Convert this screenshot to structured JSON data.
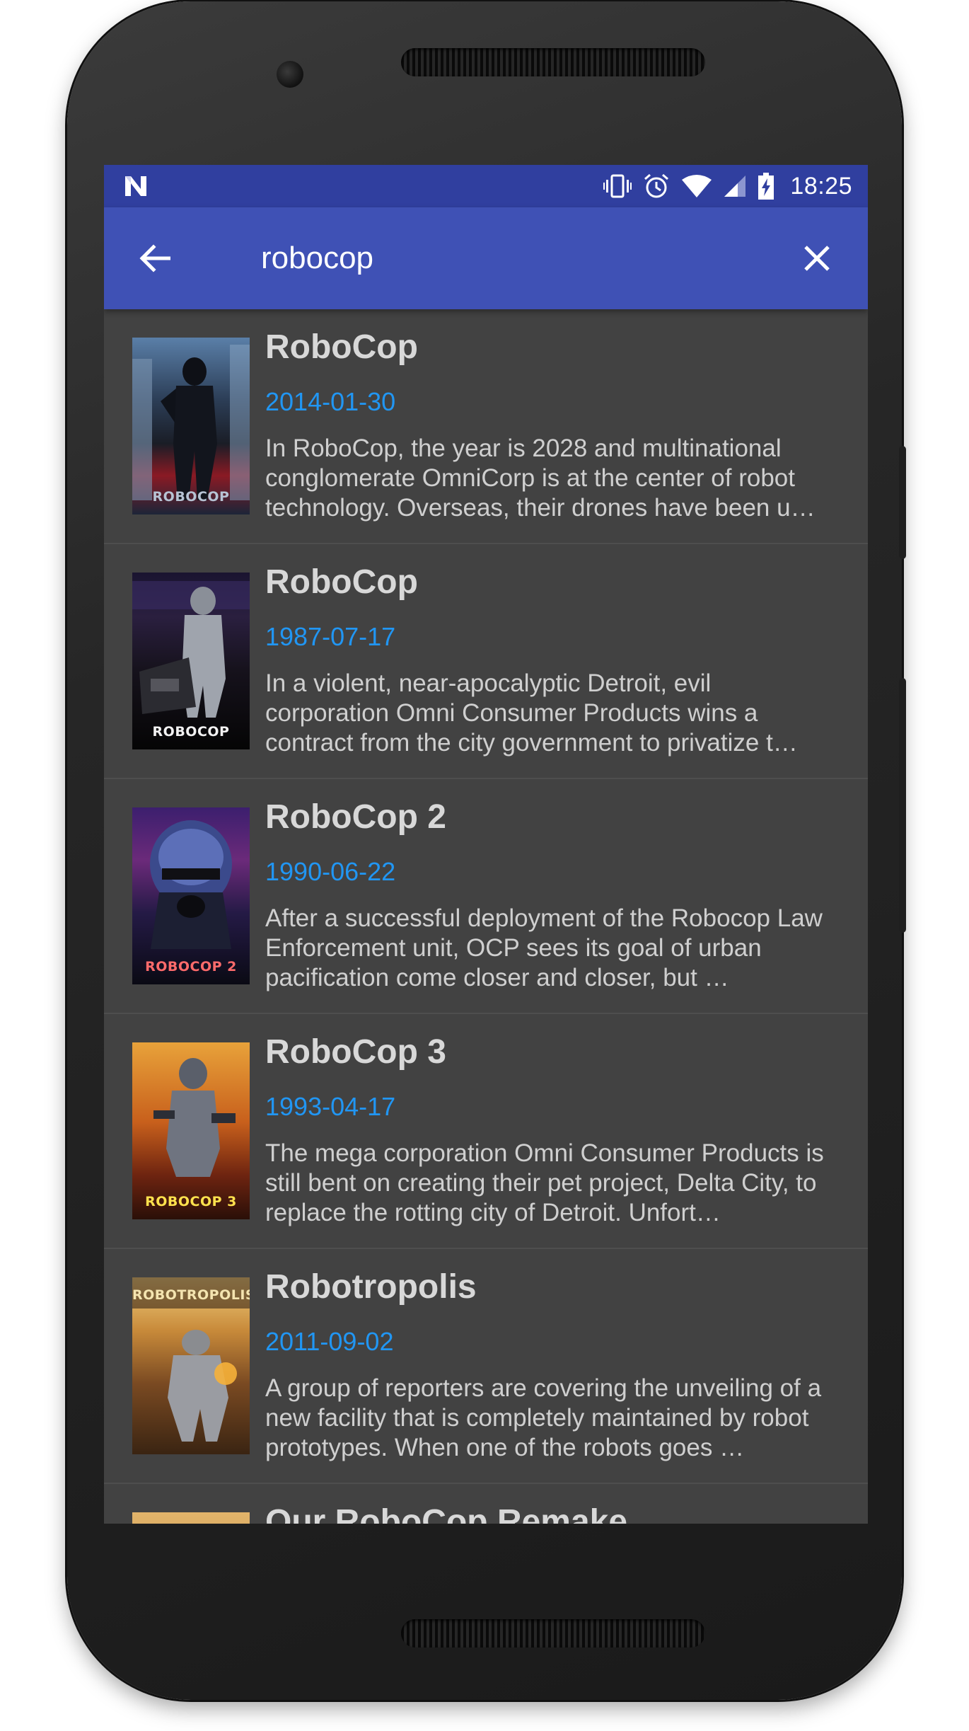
{
  "status_bar": {
    "time": "18:25",
    "icons": [
      "n-logo-icon",
      "vibrate-icon",
      "alarm-icon",
      "wifi-icon",
      "cell-signal-icon",
      "battery-charging-icon"
    ]
  },
  "app_bar": {
    "search_value": "robocop",
    "back_icon": "arrow-back-icon",
    "clear_icon": "close-icon"
  },
  "colors": {
    "status_bar": "#303f9f",
    "app_bar": "#3f51b5",
    "background": "#424242",
    "date_accent": "#2196f3"
  },
  "results": [
    {
      "title": "RoboCop",
      "date": "2014-01-30",
      "overview": "In RoboCop, the year is 2028 and multinational conglomerate OmniCorp is at the center of robot technology.  Overseas, their drones have been u…",
      "poster_caption": "ROBOCOP"
    },
    {
      "title": "RoboCop",
      "date": "1987-07-17",
      "overview": "In a violent, near-apocalyptic Detroit, evil corporation Omni Consumer Products wins a contract from the city government to privatize t…",
      "poster_caption": "ROBOCOP"
    },
    {
      "title": "RoboCop 2",
      "date": "1990-06-22",
      "overview": "After a successful deployment of the Robocop Law Enforcement unit, OCP sees its goal of urban pacification come closer and closer, but …",
      "poster_caption": "ROBOCOP 2"
    },
    {
      "title": "RoboCop 3",
      "date": "1993-04-17",
      "overview": "The mega corporation Omni Consumer Products is still bent on creating their pet project, Delta City, to replace the rotting city of Detroit. Unfort…",
      "poster_caption": "ROBOCOP 3"
    },
    {
      "title": "Robotropolis",
      "date": "2011-09-02",
      "overview": "A group of reporters are covering the unveiling of a new facility that is completely maintained by robot prototypes. When one of the robots goes …",
      "poster_caption": "ROBOTROPOLIS"
    },
    {
      "title": "Our RoboCop Remake",
      "date": "",
      "overview": "",
      "poster_caption": ""
    }
  ]
}
